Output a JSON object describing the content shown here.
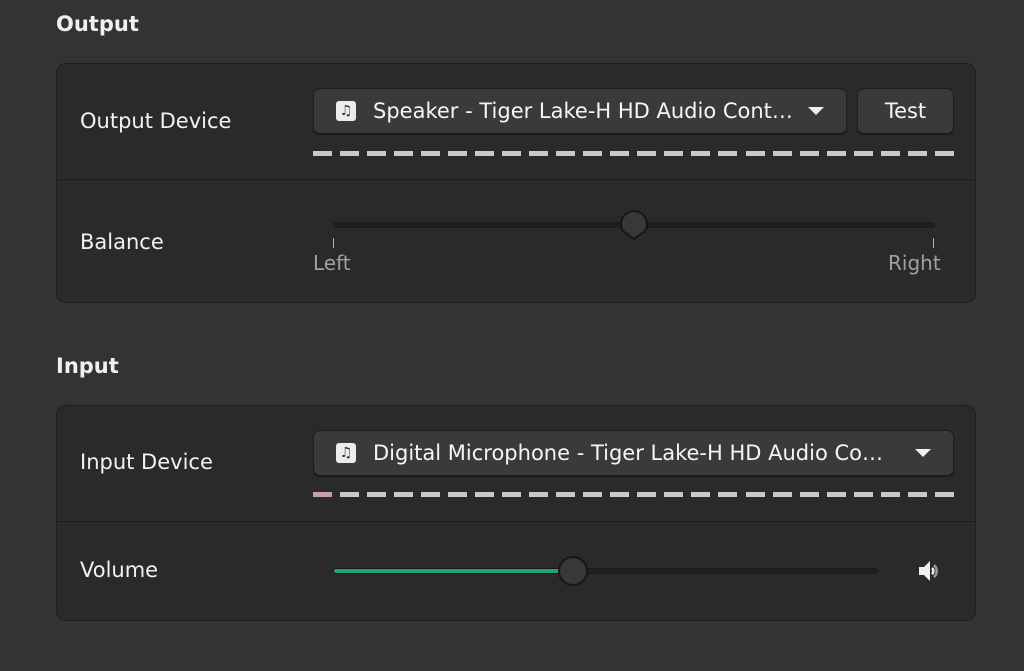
{
  "output": {
    "title": "Output",
    "device": {
      "label": "Output Device",
      "icon": "music-note-icon",
      "selected": "Speaker - Tiger Lake-H HD Audio Cont…",
      "test_label": "Test",
      "level_segments": 24,
      "level_active": 0
    },
    "balance": {
      "label": "Balance",
      "value": 0.5,
      "left_label": "Left",
      "right_label": "Right"
    }
  },
  "input": {
    "title": "Input",
    "device": {
      "label": "Input Device",
      "icon": "music-note-icon",
      "selected": "Digital Microphone - Tiger Lake-H HD Audio Co…",
      "level_segments": 24,
      "level_active": 1
    },
    "volume": {
      "label": "Volume",
      "value": 0.44,
      "icon": "speaker-volume-icon"
    }
  },
  "colors": {
    "accent": "#25a07e",
    "level_on": "#c7a0a4",
    "level_off": "#c8c8c8"
  }
}
